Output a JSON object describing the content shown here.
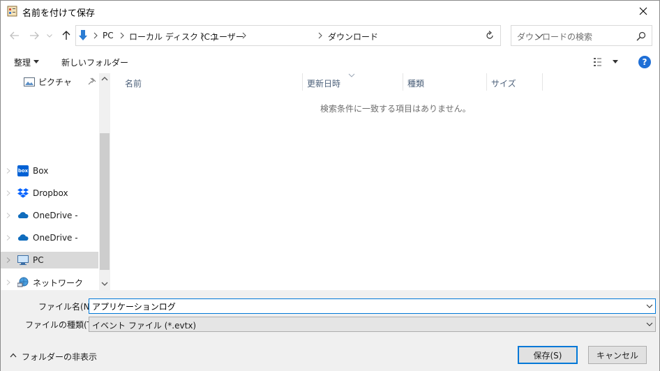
{
  "window": {
    "title": "名前を付けて保存",
    "close_glyph": "✕"
  },
  "address": {
    "segments": [
      "PC",
      "ローカル ディスク (C:)",
      "ユーザー",
      "ダウンロード"
    ],
    "separator_glyph": "›"
  },
  "search": {
    "placeholder": "ダウンロードの検索"
  },
  "toolbar": {
    "organize_label": "整理",
    "new_folder_label": "新しいフォルダー",
    "help_label": "?"
  },
  "sidebar": {
    "items": [
      {
        "label": "ピクチャ",
        "icon": "pictures-icon"
      },
      {
        "label": "Box",
        "icon": "box-icon"
      },
      {
        "label": "Dropbox",
        "icon": "dropbox-icon"
      },
      {
        "label": "OneDrive -",
        "icon": "onedrive-icon"
      },
      {
        "label": "OneDrive -",
        "icon": "onedrive-icon"
      },
      {
        "label": "PC",
        "icon": "pc-icon",
        "selected": true
      },
      {
        "label": "ネットワーク",
        "icon": "network-icon"
      }
    ]
  },
  "filelist": {
    "columns": [
      "名前",
      "更新日時",
      "種類",
      "サイズ"
    ],
    "empty_message": "検索条件に一致する項目はありません。"
  },
  "form": {
    "filename_label": "ファイル名(N):",
    "filename_value": "アプリケーションログ",
    "filetype_label": "ファイルの種類(T):",
    "filetype_value": "イベント ファイル (*.evtx)",
    "hide_folders_label": "フォルダーの非表示",
    "save_label": "保存(S)",
    "cancel_label": "キャンセル"
  },
  "colors": {
    "accent": "#0078d7",
    "selected_bg": "#d9d9d9",
    "bottom_bg": "#f0f0f0",
    "help_blue": "#1f6fd6"
  }
}
